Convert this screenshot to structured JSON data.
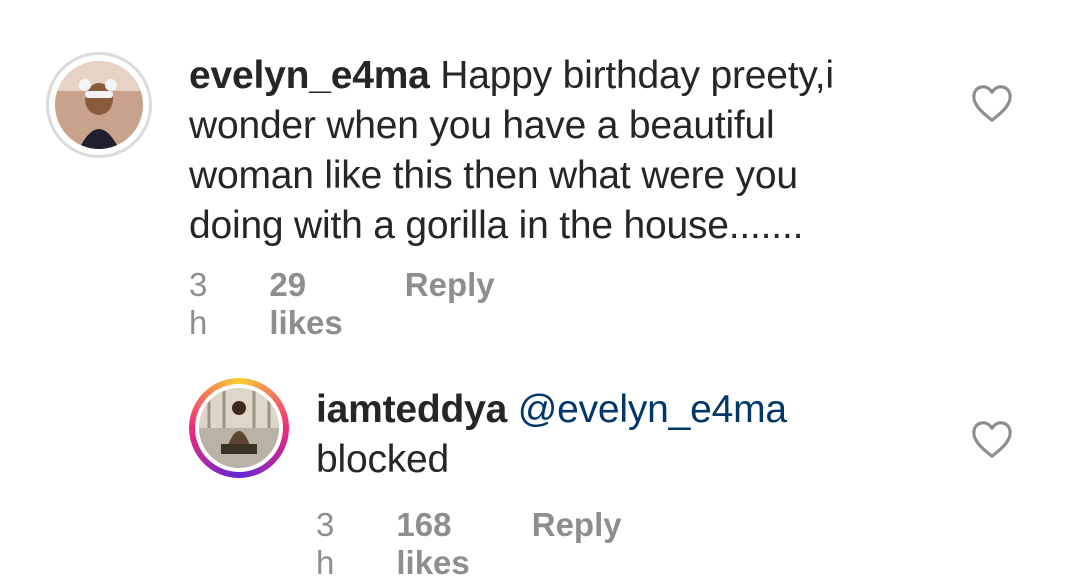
{
  "comments": [
    {
      "username": "evelyn_e4ma",
      "lines": [
        "Happy birthday preety,i",
        "wonder when you have a beautiful",
        "woman like this then what were you",
        "doing with a gorilla in the house......."
      ],
      "time": "3 h",
      "likes": "29 likes",
      "reply": "Reply",
      "avatar": "profile-photo-woman-white-sunglasses",
      "like_icon": "heart-outline-icon"
    },
    {
      "username": "iamteddya",
      "mention": "@evelyn_e4ma",
      "text": "blocked",
      "time": "3 h",
      "likes": "168 likes",
      "reply": "Reply",
      "avatar": "profile-photo-man-seated-story-ring",
      "like_icon": "heart-outline-icon"
    }
  ],
  "colors": {
    "text": "#262626",
    "secondary": "#8e8e8e",
    "mention": "#00376b",
    "avatar_border": "#dbdbdb"
  }
}
